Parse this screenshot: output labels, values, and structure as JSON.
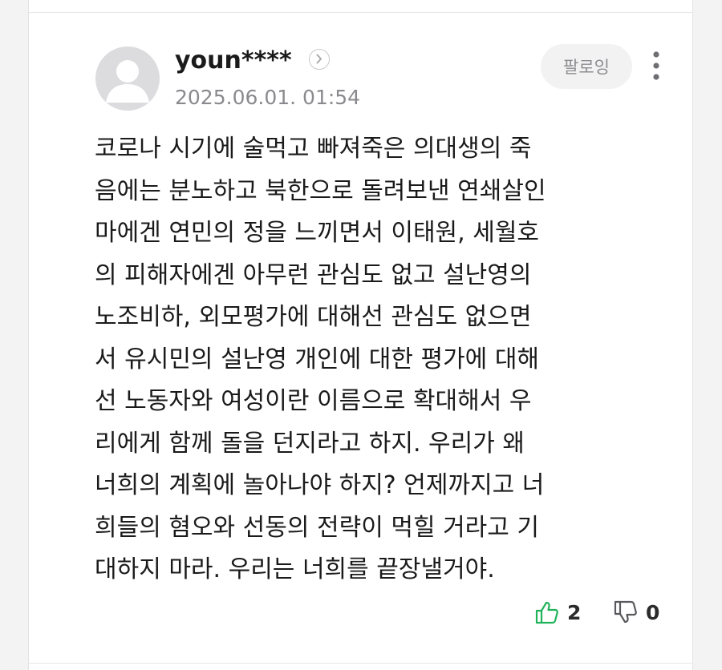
{
  "comment": {
    "author": "youn****",
    "timestamp": "2025.06.01. 01:54",
    "follow_label": "팔로잉",
    "body": "코로나 시기에 술먹고 빠져죽은 의대생의 죽\n음에는 분노하고 북한으로 돌려보낸 연쇄살인\n마에겐 연민의 정을 느끼면서 이태원, 세월호\n의 피해자에겐 아무런 관심도 없고 설난영의\n노조비하, 외모평가에 대해선 관심도 없으면\n서 유시민의 설난영 개인에 대한 평가에 대해\n선 노동자와 여성이란 이름으로 확대해서 우\n리에게 함께 돌을 던지라고 하지. 우리가 왜\n너희의 계획에 놀아나야 하지? 언제까지고 너\n희들의 혐오와 선동의 전략이 먹힐 거라고 기\n대하지 마라. 우리는 너희를 끝장낼거야.",
    "likes": "2",
    "dislikes": "0"
  },
  "icons": {
    "avatar": "default-user-avatar",
    "profile_link": "chevron-right-icon",
    "more": "vertical-ellipsis-icon",
    "like": "thumbs-up-icon",
    "dislike": "thumbs-down-icon"
  },
  "colors": {
    "like_accent": "#21b35a",
    "follow_bg": "#f2f2f3",
    "timestamp_gray": "#8a8a8e"
  }
}
